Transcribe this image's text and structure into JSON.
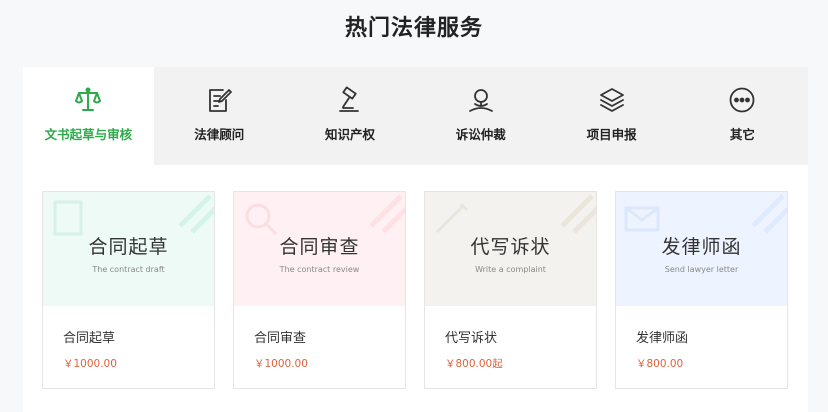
{
  "page_title": "热门法律服务",
  "tabs": [
    {
      "label": "文书起草与审核",
      "icon": "scales-icon",
      "active": true
    },
    {
      "label": "法律顾问",
      "icon": "document-edit-icon",
      "active": false
    },
    {
      "label": "知识产权",
      "icon": "gavel-icon",
      "active": false
    },
    {
      "label": "诉讼仲裁",
      "icon": "arbitration-icon",
      "active": false
    },
    {
      "label": "项目申报",
      "icon": "layers-icon",
      "active": false
    },
    {
      "label": "其它",
      "icon": "more-icon",
      "active": false
    }
  ],
  "cards": [
    {
      "banner_title": "合同起草",
      "banner_subtitle": "The contract draft",
      "name": "合同起草",
      "price": "￥1000.00",
      "tint": "#eefaf6",
      "accent": "#bfeee0"
    },
    {
      "banner_title": "合同审查",
      "banner_subtitle": "The contract review",
      "name": "合同审查",
      "price": "￥1000.00",
      "tint": "#fff1f3",
      "accent": "#ffd3da"
    },
    {
      "banner_title": "代写诉状",
      "banner_subtitle": "Write a complaint",
      "name": "代写诉状",
      "price": "￥800.00起",
      "tint": "#f4f2ee",
      "accent": "#e3ddd2"
    },
    {
      "banner_title": "发律师函",
      "banner_subtitle": "Send lawyer letter",
      "name": "发律师函",
      "price": "￥800.00",
      "tint": "#eef4ff",
      "accent": "#d3e2ff"
    }
  ],
  "colors": {
    "accent_green": "#2eaa4a",
    "price_orange": "#e0623c"
  }
}
